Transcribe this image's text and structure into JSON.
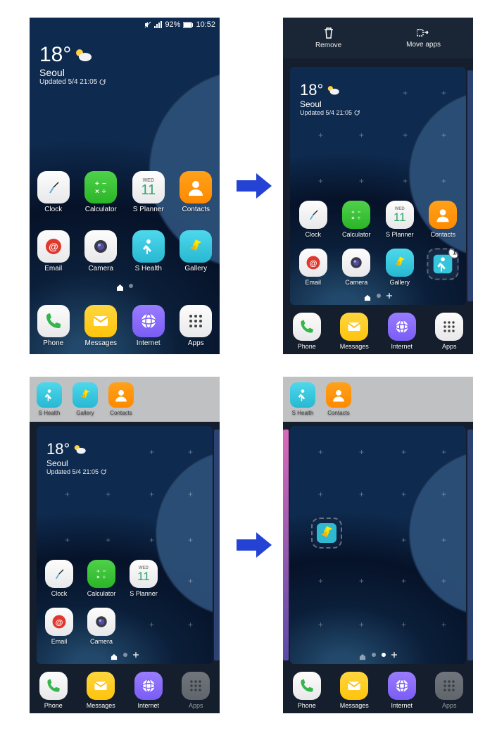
{
  "status": {
    "battery_pct": "92%",
    "time": "10:52"
  },
  "weather": {
    "temp": "18°",
    "city": "Seoul",
    "updated": "Updated 5/4 21:05"
  },
  "editbar": {
    "remove": "Remove",
    "move": "Move apps"
  },
  "apps": {
    "clock": "Clock",
    "calculator": "Calculator",
    "splanner": "S Planner",
    "contacts": "Contacts",
    "email": "Email",
    "camera": "Camera",
    "shealth": "S Health",
    "gallery": "Gallery",
    "phone": "Phone",
    "messages": "Messages",
    "internet": "Internet",
    "appsbtn": "Apps"
  },
  "splanner": {
    "dow": "WED",
    "day": "11"
  },
  "badge_count": "1"
}
